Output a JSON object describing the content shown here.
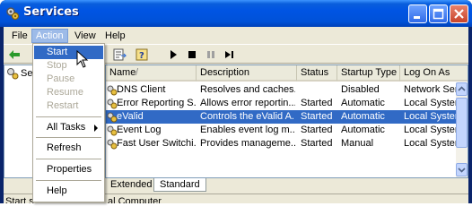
{
  "window": {
    "title": "Services"
  },
  "menubar": {
    "items": [
      "File",
      "Action",
      "View",
      "Help"
    ]
  },
  "tree": {
    "root_label": "Se"
  },
  "list": {
    "columns": [
      "Name",
      "Description",
      "Status",
      "Startup Type",
      "Log On As"
    ],
    "sort_indicator": "/",
    "rows": [
      {
        "name": "DNS Client",
        "description": "Resolves and caches...",
        "status": "",
        "startup": "Disabled",
        "logon": "Network Serv"
      },
      {
        "name": "Error Reporting S...",
        "description": "Allows error reportin...",
        "status": "Started",
        "startup": "Automatic",
        "logon": "Local System"
      },
      {
        "name": "eValid",
        "description": "Controls the eValid A...",
        "status": "Started",
        "startup": "Automatic",
        "logon": "Local System"
      },
      {
        "name": "Event Log",
        "description": "Enables event log m...",
        "status": "Started",
        "startup": "Automatic",
        "logon": "Local System"
      },
      {
        "name": "Fast User Switchi...",
        "description": "Provides manageme...",
        "status": "Started",
        "startup": "Manual",
        "logon": "Local System"
      }
    ],
    "selected_row": 2
  },
  "tabs": {
    "extended": "Extended",
    "standard": "Standard",
    "active": "Standard"
  },
  "statusbar": {
    "left": "Start s",
    "right": "al Computer"
  },
  "action_menu": {
    "start": "Start",
    "stop": "Stop",
    "pause": "Pause",
    "resume": "Resume",
    "restart": "Restart",
    "all_tasks": "All Tasks",
    "refresh": "Refresh",
    "properties": "Properties",
    "help": "Help"
  },
  "colors": {
    "titlebar": "#0054e3",
    "selection": "#316ac5",
    "menu_active": "#9dbbe8"
  }
}
